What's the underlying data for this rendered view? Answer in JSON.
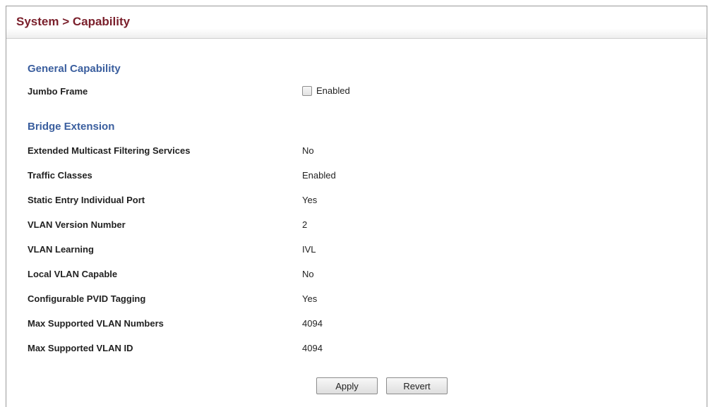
{
  "header": {
    "title": "System > Capability"
  },
  "general_capability": {
    "title": "General Capability",
    "jumbo_frame": {
      "label": "Jumbo Frame",
      "checkbox_label": "Enabled",
      "checked": false
    }
  },
  "bridge_extension": {
    "title": "Bridge Extension",
    "rows": [
      {
        "label": "Extended Multicast Filtering Services",
        "value": "No"
      },
      {
        "label": "Traffic Classes",
        "value": "Enabled"
      },
      {
        "label": "Static Entry Individual Port",
        "value": "Yes"
      },
      {
        "label": "VLAN Version Number",
        "value": "2"
      },
      {
        "label": "VLAN Learning",
        "value": "IVL"
      },
      {
        "label": "Local VLAN Capable",
        "value": "No"
      },
      {
        "label": "Configurable PVID Tagging",
        "value": "Yes"
      },
      {
        "label": "Max Supported VLAN Numbers",
        "value": "4094"
      },
      {
        "label": "Max Supported VLAN ID",
        "value": "4094"
      }
    ]
  },
  "actions": {
    "apply_label": "Apply",
    "revert_label": "Revert"
  },
  "colors": {
    "title": "#7a1f2b",
    "section_title": "#3a5e9e"
  }
}
